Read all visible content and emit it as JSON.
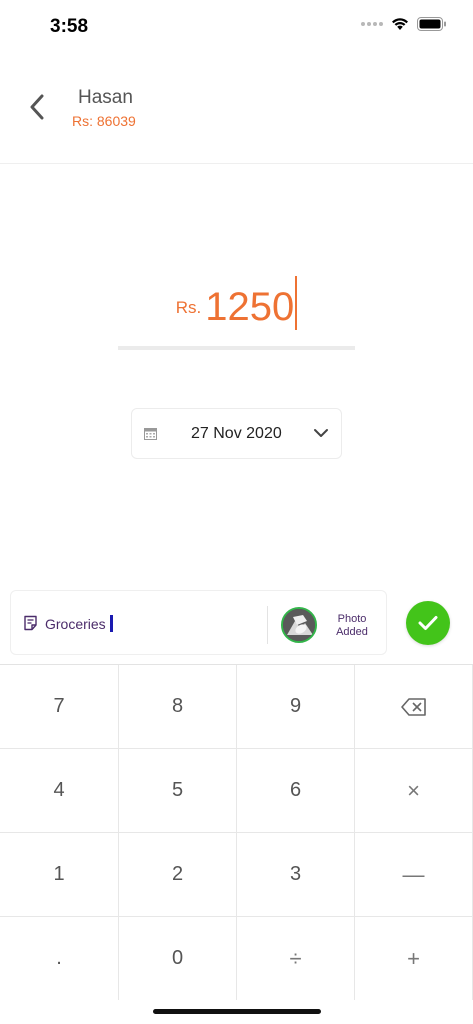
{
  "status_bar": {
    "time": "3:58"
  },
  "header": {
    "name": "Hasan",
    "balance": "Rs: 86039"
  },
  "amount": {
    "currency": "Rs.",
    "value": "1250"
  },
  "date": {
    "value": "27 Nov 2020"
  },
  "note": {
    "text": "Groceries"
  },
  "photo": {
    "status_line1": "Photo",
    "status_line2": "Added"
  },
  "keypad": {
    "keys": [
      "7",
      "8",
      "9",
      "⌫",
      "4",
      "5",
      "6",
      "×",
      "1",
      "2",
      "3",
      "—",
      ".",
      "0",
      "÷",
      "+"
    ]
  },
  "colors": {
    "accent": "#ee7233",
    "confirm": "#43c41a",
    "note_text": "#4b2c6a"
  }
}
